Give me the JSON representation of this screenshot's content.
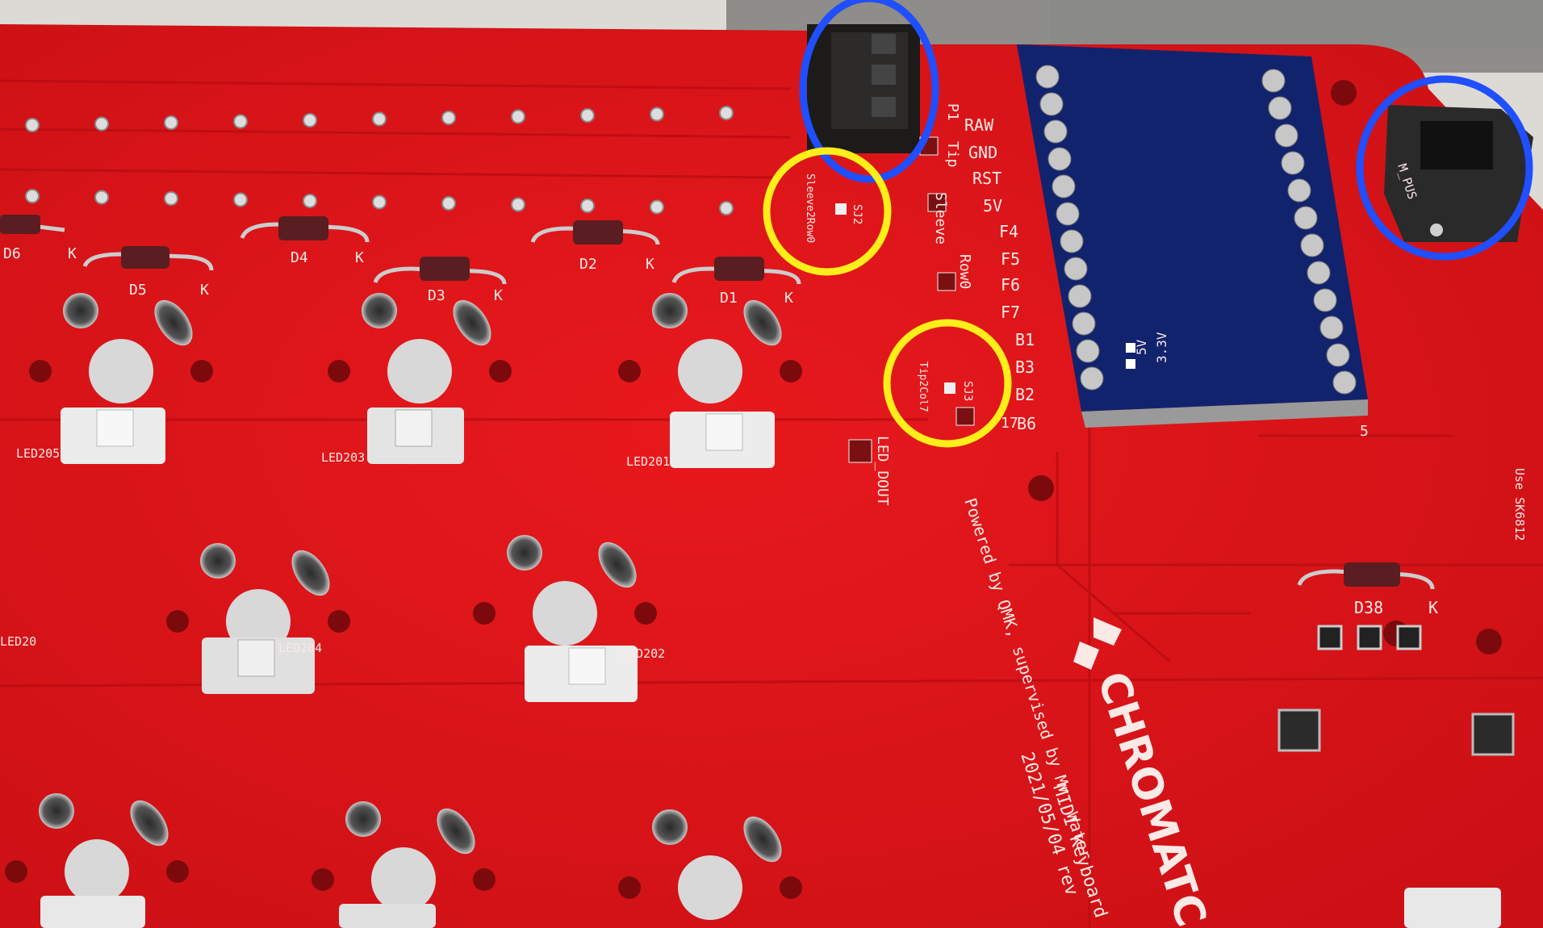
{
  "diodes": [
    "D6",
    "D5",
    "D4",
    "D3",
    "D2",
    "D1",
    "D38"
  ],
  "diode_k": "K",
  "jack_labels": [
    "Sleeve",
    "Tip",
    "P1"
  ],
  "pin_labels": [
    "RAW",
    "GND",
    "RST",
    "5V",
    "F4",
    "F5",
    "F6",
    "F7",
    "B1",
    "B3",
    "B2",
    "B6"
  ],
  "side_labels": [
    "Sleeve",
    "Row0"
  ],
  "jumper1": {
    "id": "SJ2",
    "net": "Sleeve2Row0"
  },
  "jumper2": {
    "id": "SJ3",
    "net": "Tip2Col7"
  },
  "pin_17": "17",
  "pin_5": "5",
  "led_labels": [
    "LED205",
    "LED203",
    "LED201",
    "LED20",
    "LED204",
    "LED202"
  ],
  "led_dout": "LED_DOUT",
  "usb_label": "M_PUS",
  "use_note": "Use SK6812",
  "credit_1": "Powered by QMK, supervised by Mr. Water",
  "credit_2": "2021/05/04 rev",
  "credit_3": "MIDI Keyboard",
  "brand": "CHROMATC",
  "module_marks": [
    "5V",
    "3.3V"
  ],
  "annotation_colors": {
    "blue": "#1f4fff",
    "yellow": "#ffee1a",
    "pcb": "#e0161a",
    "module": "#12236e"
  }
}
